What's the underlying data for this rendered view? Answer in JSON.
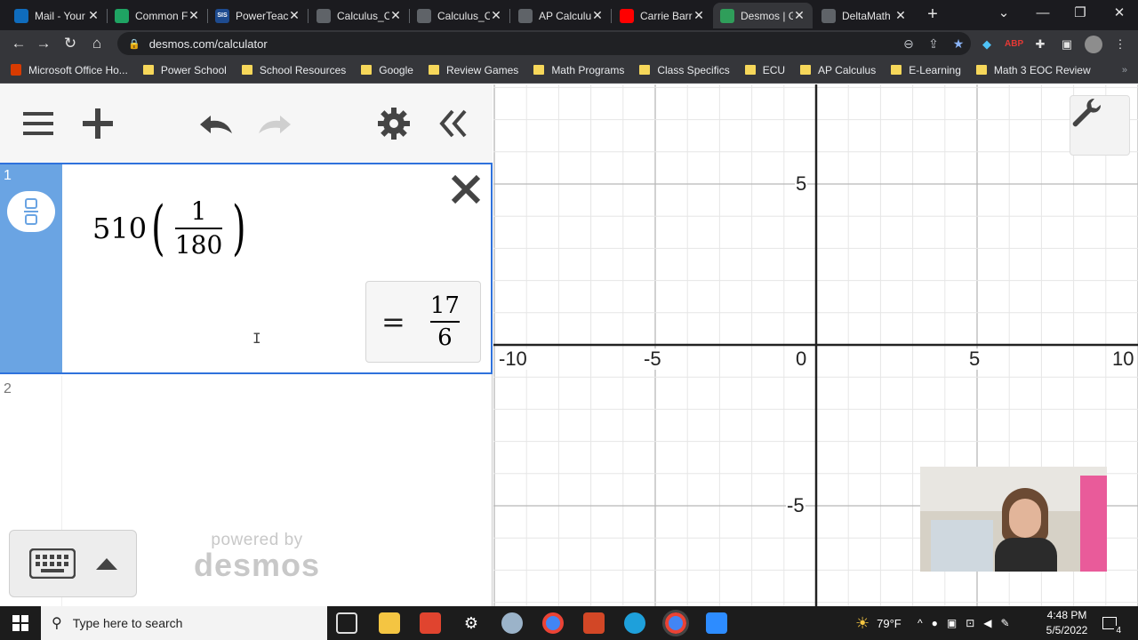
{
  "browser": {
    "tabs": [
      {
        "title": "Mail - Your",
        "favicon": "outlook-icon",
        "color": "#0f6cbd"
      },
      {
        "title": "Common F",
        "favicon": "drive-icon",
        "color": "#1fa463"
      },
      {
        "title": "PowerTeac",
        "favicon": "sis-icon",
        "color": "#1e4b8f",
        "badge": "SIS"
      },
      {
        "title": "Calculus_C",
        "favicon": "globe-icon",
        "color": "#5f6368"
      },
      {
        "title": "Calculus_C",
        "favicon": "globe-icon",
        "color": "#5f6368"
      },
      {
        "title": "AP Calculu",
        "favicon": "globe-icon",
        "color": "#5f6368"
      },
      {
        "title": "Carrie Barr",
        "favicon": "youtube-icon",
        "color": "#ff0000"
      },
      {
        "title": "Desmos | G",
        "favicon": "desmos-icon",
        "color": "#2f9e5a",
        "active": true
      },
      {
        "title": "DeltaMath",
        "favicon": "deltamath-icon",
        "color": "#5f6368"
      }
    ],
    "url": "desmos.com/calculator",
    "bookmarks": [
      {
        "label": "Microsoft Office Ho...",
        "icon": "office-icon"
      },
      {
        "label": "Power School",
        "icon": "folder-icon"
      },
      {
        "label": "School Resources",
        "icon": "folder-icon"
      },
      {
        "label": "Google",
        "icon": "folder-icon"
      },
      {
        "label": "Review Games",
        "icon": "folder-icon"
      },
      {
        "label": "Math Programs",
        "icon": "folder-icon"
      },
      {
        "label": "Class Specifics",
        "icon": "folder-icon"
      },
      {
        "label": "ECU",
        "icon": "folder-icon"
      },
      {
        "label": "AP Calculus",
        "icon": "folder-icon"
      },
      {
        "label": "E-Learning",
        "icon": "folder-icon"
      },
      {
        "label": "Math 3 EOC Review",
        "icon": "folder-icon"
      }
    ]
  },
  "desmos": {
    "accent": "#2f72dc",
    "gutter_color": "#6aa4e3",
    "expressions": [
      {
        "index": "1",
        "coefficient": "510",
        "numerator": "1",
        "denominator": "180",
        "result": {
          "equals": "=",
          "numerator": "17",
          "denominator": "6"
        }
      },
      {
        "index": "2"
      }
    ],
    "powered_by": "powered by",
    "brand": "desmos",
    "graph": {
      "x_ticks": [
        "-10",
        "-5",
        "0",
        "5",
        "10"
      ],
      "y_ticks": [
        "5",
        "-5"
      ],
      "xlim": [
        -10,
        10
      ],
      "ylim": [
        -8,
        10
      ],
      "grid": true
    }
  },
  "taskbar": {
    "search_placeholder": "Type here to search",
    "weather": "79°F",
    "time": "4:48 PM",
    "date": "5/5/2022",
    "notifications": "4"
  }
}
